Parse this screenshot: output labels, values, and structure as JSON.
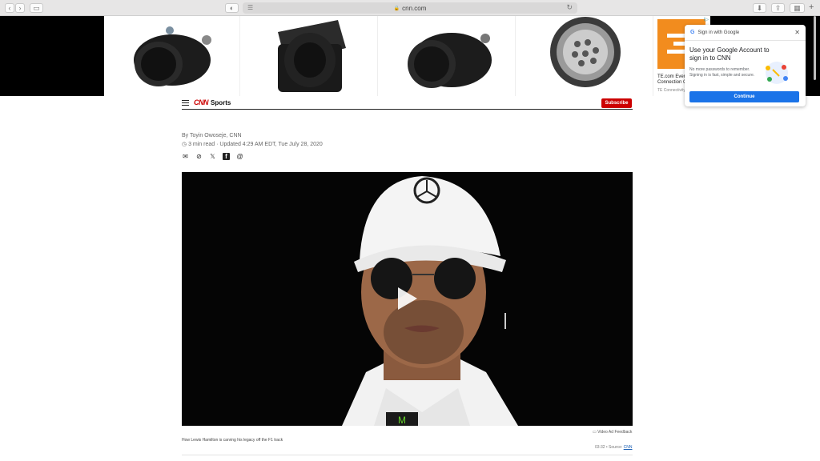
{
  "browser": {
    "url": "cnn.com",
    "lock_icon": "lock-icon",
    "reload_icon": "reload-icon"
  },
  "ad": {
    "caption": "TE.com Event Connection C",
    "source": "TE Connectivity",
    "choices": "i▷"
  },
  "header": {
    "logo": "CNN",
    "section": "Sports",
    "subscribe_label": "Subscribe"
  },
  "article": {
    "byline": "By Toyin Owoseje, CNN",
    "read_time": "3 min read",
    "separator": "·",
    "updated": "Updated 4:29 AM EDT, Tue July 28, 2020"
  },
  "share_icons": [
    "email-icon",
    "link-icon",
    "x-icon",
    "facebook-icon",
    "threads-icon"
  ],
  "video": {
    "feedback": "Video Ad Feedback",
    "caption": "How Lewis Hamilton is carving his legacy off the F1 track",
    "duration": "03:32",
    "source_prefix": "• Source:",
    "source": "CNN"
  },
  "google_popup": {
    "header": "Sign in with Google",
    "title": "Use your Google Account to sign in to CNN",
    "body": "No more passwords to remember. Signing in is fast, simple and secure.",
    "continue_label": "Continue"
  },
  "colors": {
    "cnn_red": "#cc0000",
    "google_blue": "#1a73e8",
    "ad_orange": "#f28c1e"
  }
}
